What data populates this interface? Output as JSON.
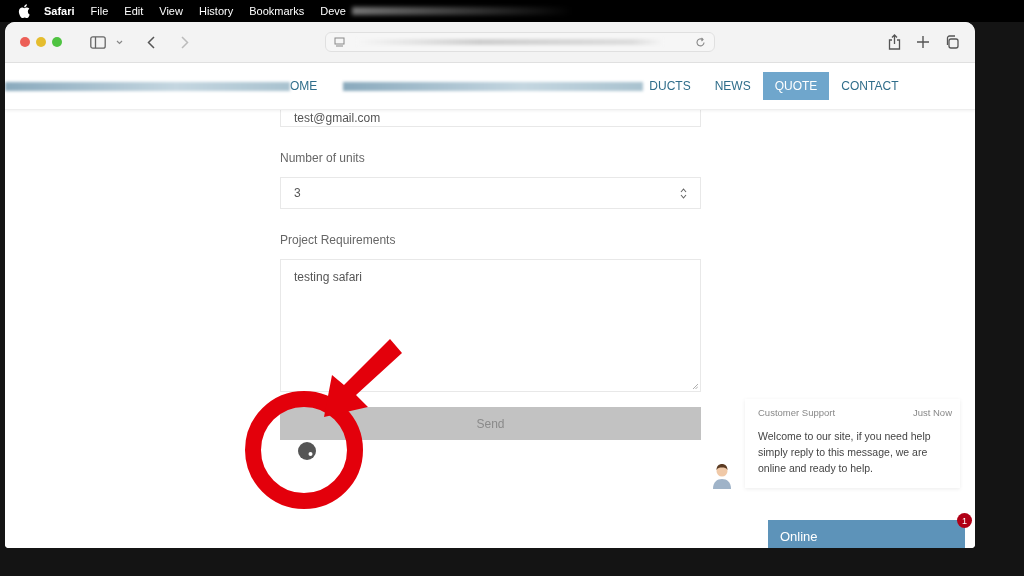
{
  "menu_bar": {
    "items": [
      {
        "label": "Safari",
        "kind": "app"
      },
      {
        "label": "File",
        "kind": "menu"
      },
      {
        "label": "Edit",
        "kind": "menu"
      },
      {
        "label": "View",
        "kind": "menu"
      },
      {
        "label": "History",
        "kind": "menu"
      },
      {
        "label": "Bookmarks",
        "kind": "menu"
      },
      {
        "label": "Deve",
        "kind": "menu"
      }
    ]
  },
  "nav": {
    "items": [
      {
        "label": "OME",
        "selected": false
      },
      {
        "label": "DUCTS",
        "selected": false
      },
      {
        "label": "NEWS",
        "selected": false
      },
      {
        "label": "QUOTE",
        "selected": true
      },
      {
        "label": "CONTACT",
        "selected": false
      }
    ]
  },
  "form": {
    "fields": [
      {
        "kind": "email",
        "value": "test@gmail.com"
      },
      {
        "kind": "number",
        "label": "Number of units",
        "value": "3"
      },
      {
        "kind": "textarea",
        "label": "Project Requirements",
        "value": "testing safari"
      }
    ],
    "send_button": {
      "label": "Send",
      "disabled": true
    }
  },
  "chat": {
    "sender": "Customer Support",
    "time": "Just Now",
    "message": "Welcome to our site, if you need help simply reply to this message, we are online and ready to help.",
    "status": "Online",
    "badge": "1"
  }
}
